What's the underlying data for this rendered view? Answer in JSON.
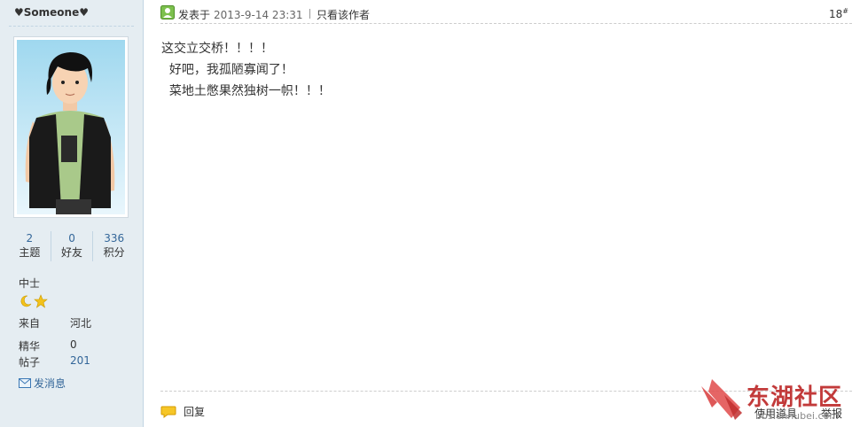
{
  "author": {
    "name": "♥Someone♥",
    "stats": [
      {
        "value": "2",
        "label": "主题"
      },
      {
        "value": "0",
        "label": "好友"
      },
      {
        "value": "336",
        "label": "积分"
      }
    ],
    "rank": "中士",
    "info": [
      {
        "label": "来自",
        "value": "河北"
      },
      {
        "label": "精华",
        "value": "0"
      },
      {
        "label": "帖子",
        "value": "201"
      }
    ],
    "send_message": "发消息"
  },
  "post": {
    "posted_label": "发表于",
    "date": "2013-9-14 23:31",
    "only_author": "只看该作者",
    "floor": "18",
    "floor_suffix": "#",
    "lines": [
      "这交立交桥！！！！",
      "  好吧，我孤陋寡闻了！",
      "  菜地土憋果然独树一帜！！！"
    ],
    "reply": "回复",
    "use_tool": "使用道具",
    "report": "举报"
  },
  "watermark": {
    "text": "东湖社区",
    "url": "bbs.cnhubei.com"
  },
  "colors": {
    "sidebar_bg": "#e5edf2",
    "link": "#336699",
    "watermark": "#c23a3a"
  }
}
